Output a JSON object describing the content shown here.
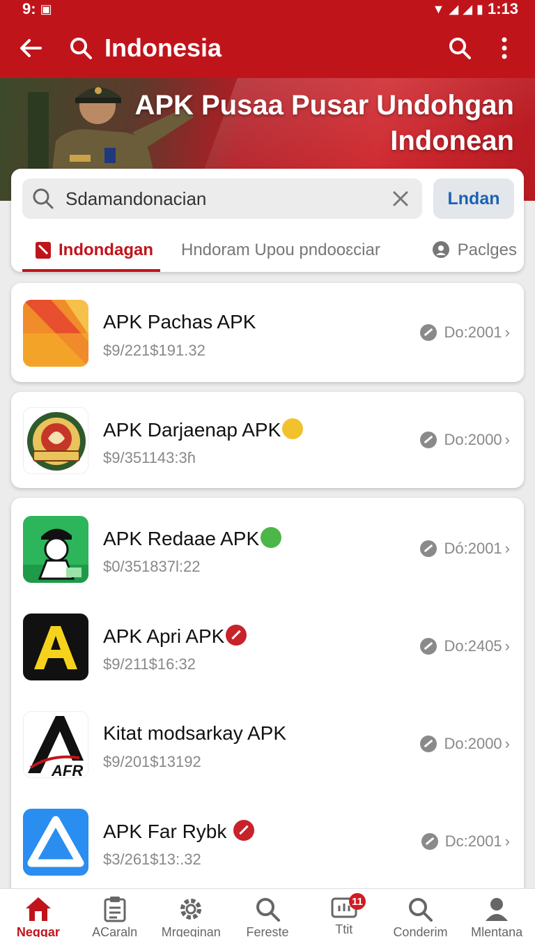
{
  "status_bar": {
    "time": "9:",
    "battery": "1:13"
  },
  "app_bar": {
    "title": "Indonesia"
  },
  "hero": {
    "line1": "APK Pusaa Pusar Undohgan",
    "line2": "Indonean"
  },
  "search": {
    "value": "Sdamandonacian",
    "button_label": "Lndan"
  },
  "tabs": [
    {
      "label": "Indondagan"
    },
    {
      "label": "Hndoram Upou pndooɛciar"
    },
    {
      "label": "Paclges"
    }
  ],
  "apps": [
    {
      "name": "APK Pachas APK",
      "price": "$9/221$191.32",
      "meta": "Do:2001",
      "icon": "orange-folder-icon"
    },
    {
      "name": "APK Darjaenap APK",
      "price": "$9/351143:3ɦ",
      "meta": "Do:2000",
      "icon": "emblem-icon",
      "badge": "emoji"
    },
    {
      "name": "APK Redaae APK",
      "price": "$0/351837l:22",
      "meta": "Dó:2001",
      "icon": "soldier-icon",
      "badge": "smile"
    },
    {
      "name": "APK Apri APK",
      "price": "$9/211$16:32",
      "meta": "Do:2405",
      "icon": "letter-a-icon",
      "badge": "red"
    },
    {
      "name": "Kitat modsarkay APK",
      "price": "$9/201$13192",
      "meta": "Do:2000",
      "icon": "afr-logo-icon"
    },
    {
      "name": "APK Far Rybk",
      "price": "$3/261$13:.32",
      "meta": "Dc:2001",
      "icon": "blue-triangle-icon",
      "badge": "red"
    }
  ],
  "bottom_nav": [
    {
      "label": "Neggar",
      "icon": "home-icon"
    },
    {
      "label": "ACaraln",
      "icon": "clipboard-icon"
    },
    {
      "label": "Mrgeginan",
      "icon": "gear-icon"
    },
    {
      "label": "Fereste",
      "icon": "search-icon"
    },
    {
      "label": "Ttit",
      "icon": "ticket-icon",
      "badge": "11"
    },
    {
      "label": "Conderim",
      "icon": "search-icon"
    },
    {
      "label": "Mlentana",
      "icon": "person-icon"
    }
  ],
  "colors": {
    "brand_red": "#c0141b",
    "link_blue": "#1a63b3"
  }
}
